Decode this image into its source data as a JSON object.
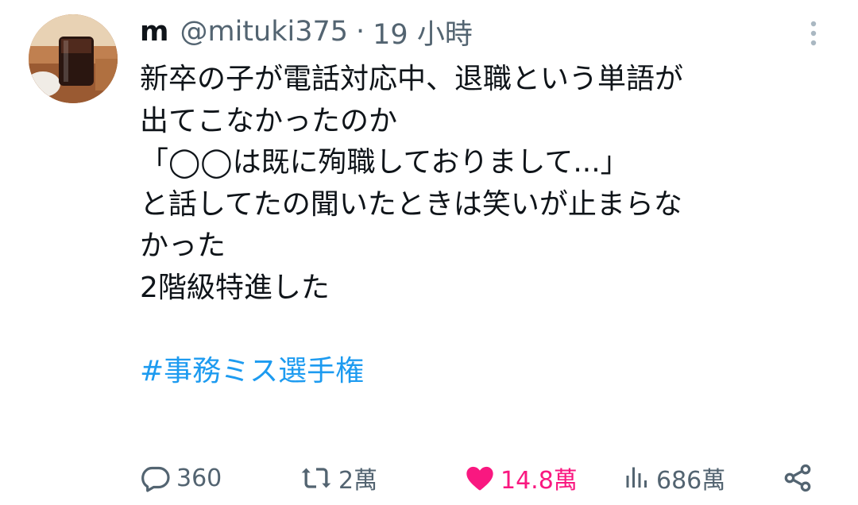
{
  "tweet": {
    "author": {
      "name": "m",
      "handle": "@mituki375",
      "separator": "·",
      "time": "19 小時"
    },
    "body_lines": [
      "新卒の子が電話対応中、退職という単語が",
      "出てこなかったのか",
      "「◯◯は既に殉職しておりまして...」",
      "と話してたの聞いたときは笑いが止まらな",
      "かった",
      "2階級特進した"
    ],
    "hashtag": "#事務ミス選手権",
    "stats": {
      "replies": "360",
      "retweets": "2萬",
      "likes": "14.8萬",
      "views": "686萬"
    },
    "icons": {
      "avatar": "avatar-photo-iced-coffee",
      "more": "more-vertical-icon",
      "reply": "reply-icon",
      "retweet": "retweet-icon",
      "like": "heart-icon",
      "views": "views-chart-icon",
      "share": "share-icon"
    },
    "colors": {
      "text": "#0f1419",
      "secondary": "#536471",
      "link": "#1d9bf0",
      "like": "#f91880"
    }
  }
}
